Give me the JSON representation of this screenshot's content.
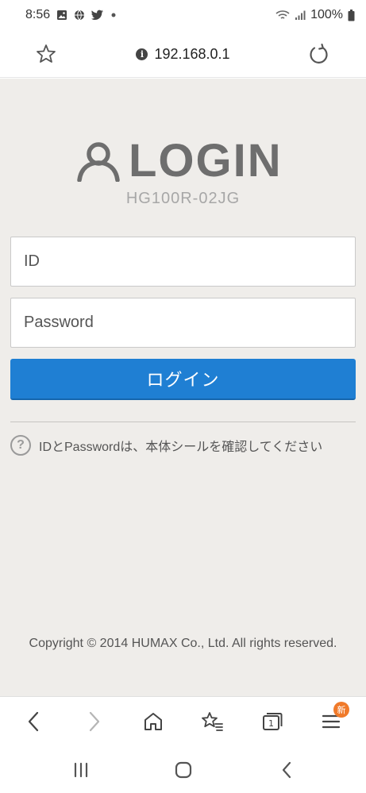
{
  "status_bar": {
    "time": "8:56",
    "battery": "100%"
  },
  "url_bar": {
    "url": "192.168.0.1"
  },
  "page": {
    "logo_text": "LOGIN",
    "model": "HG100R-02JG",
    "id_placeholder": "ID",
    "password_placeholder": "Password",
    "login_button": "ログイン",
    "help_icon_glyph": "?",
    "help_text": "IDとPasswordは、本体シールを確認してください",
    "copyright": "Copyright © 2014 HUMAX Co., Ltd. All rights reserved."
  },
  "browser_nav": {
    "tabs_count": "1",
    "menu_badge": "新"
  },
  "colors": {
    "accent": "#1f7fd3",
    "page_background": "#efedea",
    "badge": "#f07a2a"
  }
}
